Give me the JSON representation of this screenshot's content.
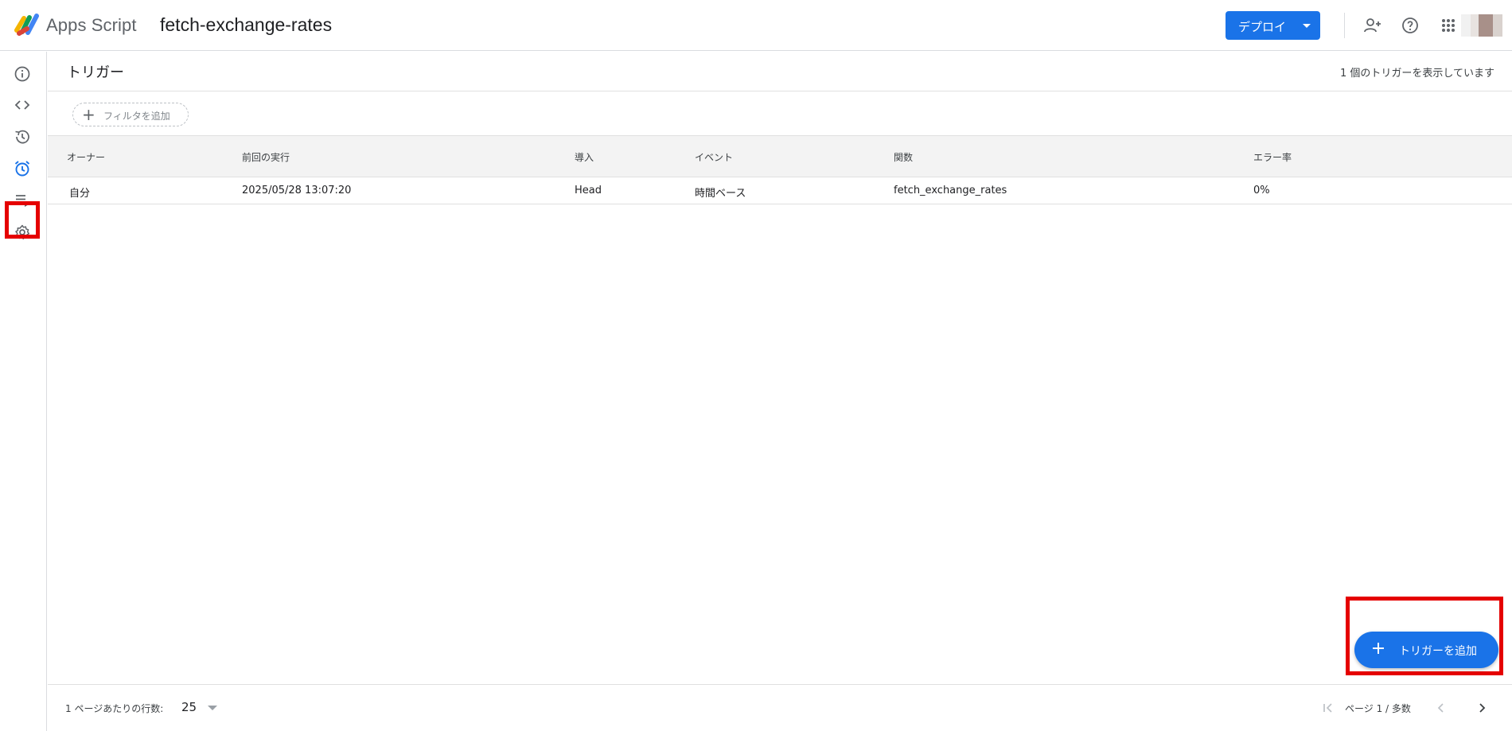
{
  "header": {
    "brand": "Apps Script",
    "project_title": "fetch-exchange-rates",
    "deploy_label": "デプロイ",
    "icons": [
      "add-person-icon",
      "help-icon",
      "apps-grid-icon",
      "avatar"
    ]
  },
  "rail": {
    "items": [
      {
        "name": "overview",
        "icon": "info-icon"
      },
      {
        "name": "editor",
        "icon": "code-icon"
      },
      {
        "name": "history",
        "icon": "history-icon"
      },
      {
        "name": "triggers",
        "icon": "alarm-icon",
        "active": true
      },
      {
        "name": "executions",
        "icon": "executions-icon"
      },
      {
        "name": "settings",
        "icon": "gear-icon"
      }
    ]
  },
  "page": {
    "title": "トリガー",
    "count_text": "1 個のトリガーを表示しています",
    "filter_label": "フィルタを追加"
  },
  "table": {
    "columns": [
      "オーナー",
      "前回の実行",
      "導入",
      "イベント",
      "関数",
      "エラー率"
    ],
    "rows": [
      [
        "自分",
        "2025/05/28 13:07:20",
        "Head",
        "時間ベース",
        "fetch_exchange_rates",
        "0%"
      ]
    ]
  },
  "fab": {
    "label": "トリガーを追加"
  },
  "footer": {
    "rows_per_page_label": "1 ページあたりの行数:",
    "rows_per_page_value": "25",
    "page_info": "ページ 1 / 多数"
  },
  "colors": {
    "accent": "#1a73e8",
    "highlight": "#e50000",
    "active_icon": "#1a73e8"
  }
}
